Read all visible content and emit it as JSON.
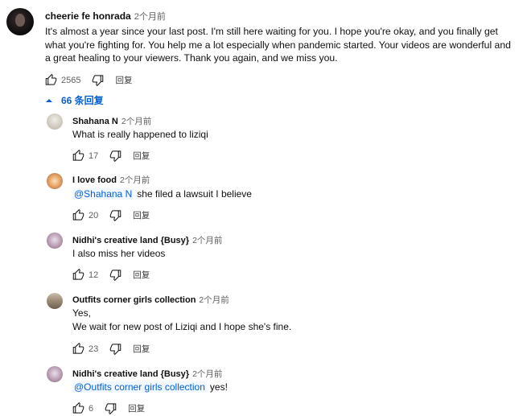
{
  "main_comment": {
    "author": "cheerie fe honrada",
    "time": "2个月前",
    "text": "It's almost a year since your last post. I'm still here waiting for you. I hope you're okay, and you finally get what you're fighting for. You help me a lot especially when pandemic started. Your videos are wonderful and a great healing to your viewers. Thank you again, and we miss you.",
    "likes": "2565",
    "reply_label": "回复"
  },
  "replies_toggle": {
    "label": "66 条回复"
  },
  "replies": [
    {
      "author": "Shahana N",
      "time": "2个月前",
      "mention": "",
      "text": "What is really happened to liziqi",
      "likes": "17",
      "reply_label": "回复"
    },
    {
      "author": "I love food",
      "time": "2个月前",
      "mention": "@Shahana N",
      "text": "she filed a lawsuit I believe",
      "likes": "20",
      "reply_label": "回复"
    },
    {
      "author": "Nidhi's creative land {Busy}",
      "time": "2个月前",
      "mention": "",
      "text": "I also miss her videos",
      "likes": "12",
      "reply_label": "回复"
    },
    {
      "author": "Outfits corner girls collection",
      "time": "2个月前",
      "mention": "",
      "text_line1": "Yes,",
      "text_line2": "We wait for new post of Liziqi and I hope she's fine.",
      "likes": "23",
      "reply_label": "回复"
    },
    {
      "author": "Nidhi's creative land {Busy}",
      "time": "2个月前",
      "mention": "@Outfits corner girls collection",
      "text": "yes!",
      "likes": "6",
      "reply_label": "回复"
    }
  ],
  "colors": {
    "link_blue": "#065fd4",
    "meta_gray": "#606060",
    "text": "#0f0f0f"
  },
  "icons": {
    "like": "thumb-up-icon",
    "dislike": "thumb-down-icon",
    "collapse": "caret-up-icon"
  }
}
